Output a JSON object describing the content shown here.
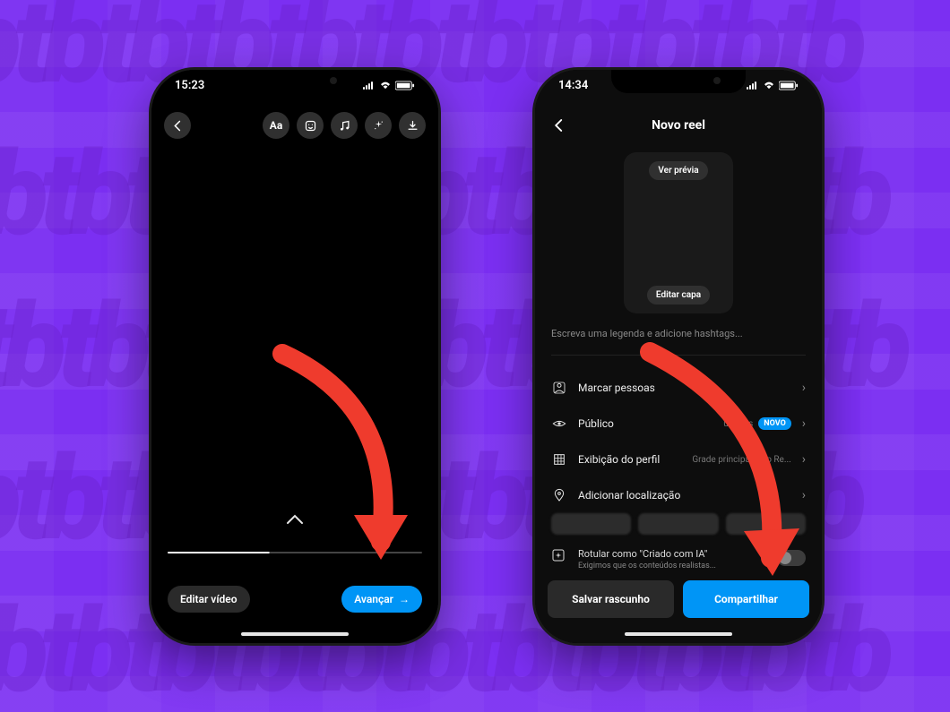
{
  "background": {
    "pattern_text": "tbtbtbtbtbtbtbtbtbtbtb",
    "color": "#7b2ff2"
  },
  "status_left": {
    "time": "15:23"
  },
  "status_right": {
    "time": "14:34"
  },
  "left_phone": {
    "toolbar_icons": [
      "text-aa-icon",
      "sticker-icon",
      "music-icon",
      "effects-icon",
      "download-icon"
    ],
    "aa_label": "Aa",
    "edit_video_label": "Editar vídeo",
    "next_label": "Avançar"
  },
  "right_phone": {
    "header_title": "Novo reel",
    "preview_top": "Ver prévia",
    "preview_bottom": "Editar capa",
    "caption_placeholder": "Escreva uma legenda e adicione hashtags...",
    "items": [
      {
        "icon": "tag-people-icon",
        "label": "Marcar pessoas",
        "trail": ""
      },
      {
        "icon": "eye-icon",
        "label": "Público",
        "trail": "uidores",
        "badge": "NOVO"
      },
      {
        "icon": "grid-icon",
        "label": "Exibição do perfil",
        "trail": "Grade principal e do Re..."
      },
      {
        "icon": "location-icon",
        "label": "Adicionar localização",
        "trail": ""
      }
    ],
    "ai_row": {
      "title": "Rotular como \"Criado com IA\"",
      "subtitle": "Exigimos que os conteúdos realistas..."
    },
    "footer": {
      "draft": "Salvar rascunho",
      "share": "Compartilhar"
    }
  }
}
